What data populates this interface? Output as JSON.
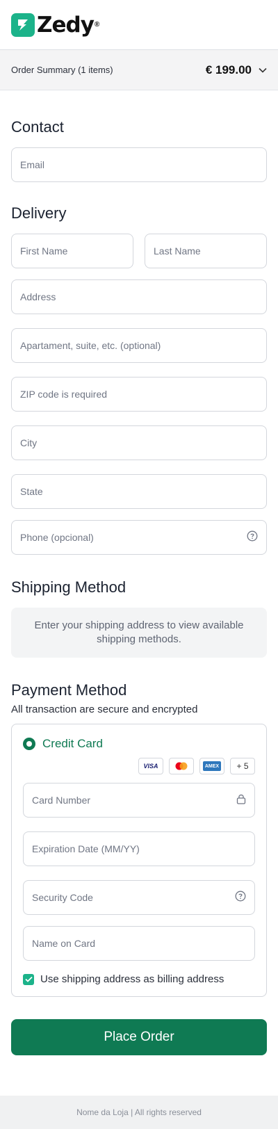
{
  "brand": {
    "name": "Zedy",
    "reg_mark": "®",
    "accent": "#1cb38a",
    "primary": "#0f7a53"
  },
  "order_summary": {
    "label": "Order Summary (1 items)",
    "total": "€ 199.00",
    "toggle_icon": "chevron-down-icon"
  },
  "contact": {
    "title": "Contact",
    "email_placeholder": "Email"
  },
  "delivery": {
    "title": "Delivery",
    "first_name_placeholder": "First Name",
    "last_name_placeholder": "Last Name",
    "address_placeholder": "Address",
    "apartment_placeholder": "Apartament, suite, etc. (optional)",
    "zip_placeholder": "ZIP code is required",
    "city_placeholder": "City",
    "state_placeholder": "State",
    "phone_placeholder": "Phone (opcional)"
  },
  "shipping": {
    "title": "Shipping Method",
    "message": "Enter your shipping address to view available shipping methods."
  },
  "payment": {
    "title": "Payment Method",
    "subtitle": "All transaction are secure and encrypted",
    "method_label": "Credit Card",
    "brands": [
      "VISA",
      "mastercard",
      "AMEX"
    ],
    "more_brands": "+ 5",
    "card_number_placeholder": "Card Number",
    "expiration_placeholder": "Expiration Date (MM/YY)",
    "security_code_placeholder": "Security Code",
    "name_on_card_placeholder": "Name on Card",
    "billing_same_label": "Use shipping address as billing address",
    "billing_same_checked": true
  },
  "actions": {
    "place_order_label": "Place Order"
  },
  "footer": {
    "text": "Nome da Loja | All rights reserved"
  }
}
